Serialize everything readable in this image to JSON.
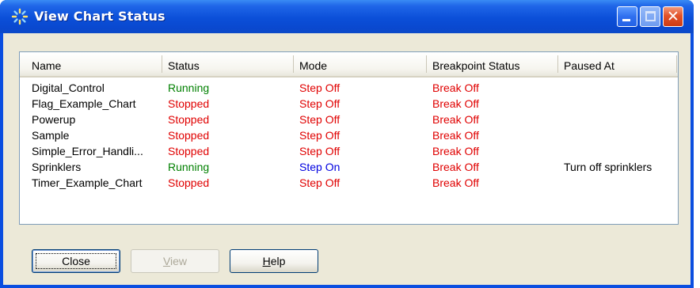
{
  "window": {
    "title": "View Chart Status"
  },
  "list": {
    "columns": [
      "Name",
      "Status",
      "Mode",
      "Breakpoint Status",
      "Paused At"
    ],
    "rows": [
      {
        "name": "Digital_Control",
        "status": "Running",
        "mode": "Step Off",
        "breakpoint": "Break Off",
        "paused_at": ""
      },
      {
        "name": "Flag_Example_Chart",
        "status": "Stopped",
        "mode": "Step Off",
        "breakpoint": "Break Off",
        "paused_at": ""
      },
      {
        "name": "Powerup",
        "status": "Stopped",
        "mode": "Step Off",
        "breakpoint": "Break Off",
        "paused_at": ""
      },
      {
        "name": "Sample",
        "status": "Stopped",
        "mode": "Step Off",
        "breakpoint": "Break Off",
        "paused_at": ""
      },
      {
        "name": "Simple_Error_Handli...",
        "status": "Stopped",
        "mode": "Step Off",
        "breakpoint": "Break Off",
        "paused_at": ""
      },
      {
        "name": "Sprinklers",
        "status": "Running",
        "mode": "Step On",
        "breakpoint": "Break Off",
        "paused_at": "Turn off sprinklers"
      },
      {
        "name": "Timer_Example_Chart",
        "status": "Stopped",
        "mode": "Step Off",
        "breakpoint": "Break Off",
        "paused_at": ""
      }
    ]
  },
  "buttons": {
    "close": "Close",
    "view_rest": "iew",
    "view_accel": "V",
    "help_accel": "H",
    "help_rest": "elp"
  },
  "colors": {
    "running": "#008000",
    "stopped": "#e00000",
    "step_off": "#e00000",
    "step_on": "#0000e0",
    "break_off": "#e00000",
    "titlebar": "#0a4ee0"
  }
}
